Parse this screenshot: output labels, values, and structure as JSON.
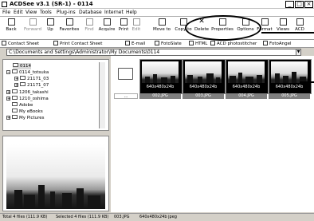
{
  "window": {
    "title": "ACDSee v3.1 (SR-1) - 0114",
    "minimize": "_",
    "maximize": "□",
    "close": "×"
  },
  "menu": [
    "File",
    "Edit",
    "View",
    "Tools",
    "Plug-ins",
    "Database",
    "Internet",
    "Help"
  ],
  "toolbar": {
    "back": "Back",
    "forward": "Forward",
    "up": "Up",
    "favorites": "Favorites",
    "find": "Find",
    "acquire": "Acquire",
    "print": "Print",
    "edit": "Edit",
    "move_to": "Move to",
    "copy_to": "Copy to",
    "delete": "Delete",
    "properties": "Properties",
    "options": "Options",
    "format": "Format",
    "views": "Views",
    "acdsee": "ACD"
  },
  "toolbar2": {
    "contact_sheet": "Contact Sheet",
    "print_contact_sheet": "Print Contact Sheet",
    "email": "E-mail",
    "fotoslate": "FotoSlate",
    "html": "HTML",
    "photostitcher": "ACD photostitcher",
    "more": "FotoAngel"
  },
  "address": "C:\\Documents and Settings\\Administrator\\My Documents\\0114",
  "folder_tree": [
    {
      "label": "0114",
      "selected": true
    },
    {
      "label": "0114_totsuka"
    },
    {
      "label": "21171_03"
    },
    {
      "label": "21171_07"
    },
    {
      "label": "1206_takashi"
    },
    {
      "label": "1210_oshima"
    },
    {
      "label": "Adobe"
    },
    {
      "label": "My eBooks"
    },
    {
      "label": "My Pictures"
    }
  ],
  "files": {
    "up_folder_name": "...",
    "items": [
      {
        "name": "002.JPG",
        "info": "640x480x24b"
      },
      {
        "name": "003.JPG",
        "info": "640x480x24b"
      },
      {
        "name": "004.JPG",
        "info": "640x480x24b"
      },
      {
        "name": "005.JPG",
        "info": "640x480x24b"
      }
    ]
  },
  "status": {
    "total": "Total 4 files (111.9 KB)",
    "selected": "Selected 4 files (111.9 KB)",
    "current": "003.JPG",
    "format": "640x480x24b jpeg"
  },
  "colors": {
    "window_bg": "#d4d0c8",
    "selection_gray": "#808080",
    "annotation": "#000000"
  }
}
